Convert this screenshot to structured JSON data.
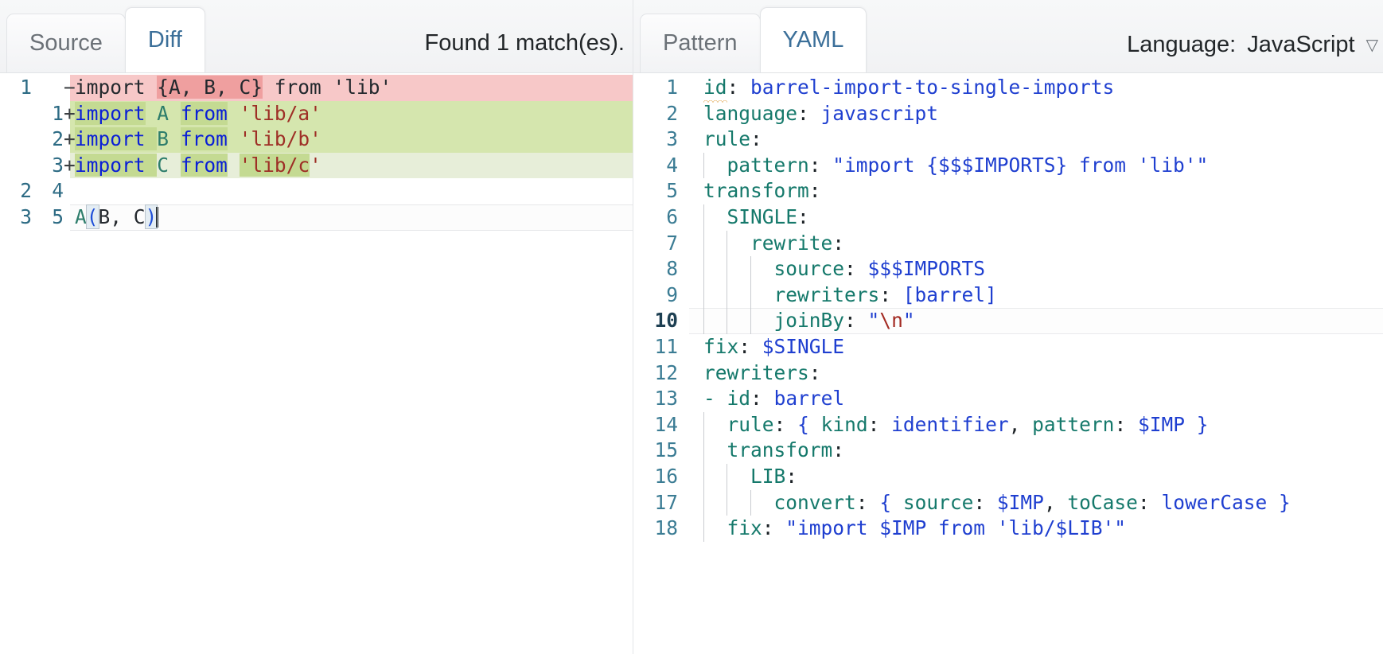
{
  "left": {
    "tabs": [
      {
        "label": "Source",
        "active": false
      },
      {
        "label": "Diff",
        "active": true
      }
    ],
    "status": "Found 1 match(es).",
    "diff": {
      "rows": [
        {
          "old_no": "1",
          "new_no": "",
          "sign": "−",
          "kind": "del",
          "segments": [
            {
              "text": "import ",
              "cls": "plain",
              "word": false
            },
            {
              "text": "{A, B, C}",
              "cls": "plain",
              "word": true
            },
            {
              "text": " from 'lib'",
              "cls": "plain",
              "word": false
            }
          ]
        },
        {
          "old_no": "",
          "new_no": "1",
          "sign": "+",
          "kind": "add",
          "segments": [
            {
              "text": "import",
              "cls": "kw",
              "word": true
            },
            {
              "text": " ",
              "cls": "plain",
              "word": false
            },
            {
              "text": "A",
              "cls": "id2",
              "word": false
            },
            {
              "text": " ",
              "cls": "plain",
              "word": false
            },
            {
              "text": "from",
              "cls": "kw",
              "word": true
            },
            {
              "text": " ",
              "cls": "plain",
              "word": false
            },
            {
              "text": "'lib/a'",
              "cls": "str",
              "word": false
            }
          ]
        },
        {
          "old_no": "",
          "new_no": "2",
          "sign": "+",
          "kind": "add",
          "segments": [
            {
              "text": "import",
              "cls": "kw",
              "word": true
            },
            {
              "text": " ",
              "cls": "plain",
              "word": true
            },
            {
              "text": "B",
              "cls": "id2",
              "word": false
            },
            {
              "text": " ",
              "cls": "plain",
              "word": false
            },
            {
              "text": "from",
              "cls": "kw",
              "word": true
            },
            {
              "text": " ",
              "cls": "plain",
              "word": false
            },
            {
              "text": "'lib/b'",
              "cls": "str",
              "word": false
            }
          ]
        },
        {
          "old_no": "",
          "new_no": "3",
          "sign": "+",
          "kind": "add-faint",
          "segments": [
            {
              "text": "import",
              "cls": "kw",
              "word": true
            },
            {
              "text": " ",
              "cls": "plain",
              "word": true
            },
            {
              "text": "C",
              "cls": "id2",
              "word": false
            },
            {
              "text": " ",
              "cls": "plain",
              "word": false
            },
            {
              "text": "from",
              "cls": "kw",
              "word": true
            },
            {
              "text": " ",
              "cls": "plain",
              "word": false
            },
            {
              "text": "'lib/c",
              "cls": "str",
              "word": true
            },
            {
              "text": "'",
              "cls": "str",
              "word": false
            }
          ]
        },
        {
          "old_no": "2",
          "new_no": "4",
          "sign": "",
          "kind": "ctx",
          "segments": []
        },
        {
          "old_no": "3",
          "new_no": "5",
          "sign": "",
          "kind": "cur",
          "segments": [
            {
              "text": "A",
              "cls": "fn",
              "word": false
            },
            {
              "text": "(",
              "cls": "punct",
              "word": false,
              "box": true
            },
            {
              "text": "B, C",
              "cls": "plain",
              "word": false
            },
            {
              "text": ")",
              "cls": "punct",
              "word": false,
              "box": true
            }
          ],
          "caret": true
        }
      ]
    }
  },
  "right": {
    "tabs": [
      {
        "label": "Pattern",
        "active": false
      },
      {
        "label": "YAML",
        "active": true
      }
    ],
    "language_label": "Language:",
    "language_value": "JavaScript",
    "caret_glyph": "▽",
    "yaml": {
      "active_line": 10,
      "lines": [
        {
          "no": "1",
          "indent": 0,
          "guides": 0,
          "text": "id: barrel-import-to-single-imports",
          "tokens": [
            {
              "t": "id",
              "c": "ykey",
              "squiggle": true
            },
            {
              "t": ":",
              "c": "ycolon"
            },
            {
              "t": " barrel-import-to-single-imports",
              "c": "yval"
            }
          ]
        },
        {
          "no": "2",
          "indent": 0,
          "guides": 0,
          "text": "language: javascript",
          "tokens": [
            {
              "t": "language",
              "c": "ykey"
            },
            {
              "t": ":",
              "c": "ycolon"
            },
            {
              "t": " javascript",
              "c": "yval"
            }
          ]
        },
        {
          "no": "3",
          "indent": 0,
          "guides": 0,
          "text": "rule:",
          "tokens": [
            {
              "t": "rule",
              "c": "ykey"
            },
            {
              "t": ":",
              "c": "ycolon"
            }
          ]
        },
        {
          "no": "4",
          "indent": 1,
          "guides": 1,
          "text": "  pattern: \"import {$$$IMPORTS} from 'lib'\"",
          "tokens": [
            {
              "t": "  ",
              "c": "plain"
            },
            {
              "t": "pattern",
              "c": "ykey"
            },
            {
              "t": ":",
              "c": "ycolon"
            },
            {
              "t": " \"import {$$$IMPORTS} from 'lib'\"",
              "c": "ystr"
            }
          ]
        },
        {
          "no": "5",
          "indent": 0,
          "guides": 0,
          "text": "transform:",
          "tokens": [
            {
              "t": "transform",
              "c": "ykey"
            },
            {
              "t": ":",
              "c": "ycolon"
            }
          ]
        },
        {
          "no": "6",
          "indent": 1,
          "guides": 1,
          "text": "  SINGLE:",
          "tokens": [
            {
              "t": "  ",
              "c": "plain"
            },
            {
              "t": "SINGLE",
              "c": "ykey"
            },
            {
              "t": ":",
              "c": "ycolon"
            }
          ]
        },
        {
          "no": "7",
          "indent": 2,
          "guides": 2,
          "text": "    rewrite:",
          "tokens": [
            {
              "t": "    ",
              "c": "plain"
            },
            {
              "t": "rewrite",
              "c": "ykey"
            },
            {
              "t": ":",
              "c": "ycolon"
            }
          ]
        },
        {
          "no": "8",
          "indent": 3,
          "guides": 3,
          "text": "      source: $$$IMPORTS",
          "tokens": [
            {
              "t": "      ",
              "c": "plain"
            },
            {
              "t": "source",
              "c": "ykey"
            },
            {
              "t": ":",
              "c": "ycolon"
            },
            {
              "t": " $$$IMPORTS",
              "c": "yval"
            }
          ]
        },
        {
          "no": "9",
          "indent": 3,
          "guides": 3,
          "text": "      rewriters: [barrel]",
          "tokens": [
            {
              "t": "      ",
              "c": "plain"
            },
            {
              "t": "rewriters",
              "c": "ykey"
            },
            {
              "t": ":",
              "c": "ycolon"
            },
            {
              "t": " [barrel]",
              "c": "yval"
            }
          ]
        },
        {
          "no": "10",
          "indent": 3,
          "guides": 3,
          "text": "      joinBy: \"\\n\"",
          "tokens": [
            {
              "t": "      ",
              "c": "plain"
            },
            {
              "t": "joinBy",
              "c": "ykey"
            },
            {
              "t": ":",
              "c": "ycolon"
            },
            {
              "t": " \"",
              "c": "ystr"
            },
            {
              "t": "\\n",
              "c": "yesc"
            },
            {
              "t": "\"",
              "c": "ystr"
            }
          ]
        },
        {
          "no": "11",
          "indent": 0,
          "guides": 0,
          "text": "fix: $SINGLE",
          "tokens": [
            {
              "t": "fix",
              "c": "ykey"
            },
            {
              "t": ":",
              "c": "ycolon"
            },
            {
              "t": " $SINGLE",
              "c": "yval"
            }
          ]
        },
        {
          "no": "12",
          "indent": 0,
          "guides": 0,
          "text": "rewriters:",
          "tokens": [
            {
              "t": "rewriters",
              "c": "ykey"
            },
            {
              "t": ":",
              "c": "ycolon"
            }
          ]
        },
        {
          "no": "13",
          "indent": 0,
          "guides": 0,
          "text": "- id: barrel",
          "tokens": [
            {
              "t": "-",
              "c": "ydash"
            },
            {
              "t": " ",
              "c": "plain"
            },
            {
              "t": "id",
              "c": "ykey"
            },
            {
              "t": ":",
              "c": "ycolon"
            },
            {
              "t": " barrel",
              "c": "yval"
            }
          ]
        },
        {
          "no": "14",
          "indent": 1,
          "guides": 1,
          "text": "  rule: { kind: identifier, pattern: $IMP }",
          "tokens": [
            {
              "t": "  ",
              "c": "plain"
            },
            {
              "t": "rule",
              "c": "ykey"
            },
            {
              "t": ":",
              "c": "ycolon"
            },
            {
              "t": " ",
              "c": "plain"
            },
            {
              "t": "{",
              "c": "yval"
            },
            {
              "t": " ",
              "c": "plain"
            },
            {
              "t": "kind",
              "c": "ykey"
            },
            {
              "t": ":",
              "c": "ycolon"
            },
            {
              "t": " identifier",
              "c": "yval"
            },
            {
              "t": ",",
              "c": "ycolon"
            },
            {
              "t": " ",
              "c": "plain"
            },
            {
              "t": "pattern",
              "c": "ykey"
            },
            {
              "t": ":",
              "c": "ycolon"
            },
            {
              "t": " $IMP }",
              "c": "yval"
            }
          ]
        },
        {
          "no": "15",
          "indent": 1,
          "guides": 1,
          "text": "  transform:",
          "tokens": [
            {
              "t": "  ",
              "c": "plain"
            },
            {
              "t": "transform",
              "c": "ykey"
            },
            {
              "t": ":",
              "c": "ycolon"
            }
          ]
        },
        {
          "no": "16",
          "indent": 2,
          "guides": 2,
          "text": "    LIB:",
          "tokens": [
            {
              "t": "    ",
              "c": "plain"
            },
            {
              "t": "LIB",
              "c": "ykey"
            },
            {
              "t": ":",
              "c": "ycolon"
            }
          ]
        },
        {
          "no": "17",
          "indent": 3,
          "guides": 3,
          "text": "      convert: { source: $IMP, toCase: lowerCase }",
          "tokens": [
            {
              "t": "      ",
              "c": "plain"
            },
            {
              "t": "convert",
              "c": "ykey"
            },
            {
              "t": ":",
              "c": "ycolon"
            },
            {
              "t": " ",
              "c": "plain"
            },
            {
              "t": "{",
              "c": "yval"
            },
            {
              "t": " ",
              "c": "plain"
            },
            {
              "t": "source",
              "c": "ykey"
            },
            {
              "t": ":",
              "c": "ycolon"
            },
            {
              "t": " $IMP",
              "c": "yval"
            },
            {
              "t": ",",
              "c": "ycolon"
            },
            {
              "t": " ",
              "c": "plain"
            },
            {
              "t": "toCase",
              "c": "ykey"
            },
            {
              "t": ":",
              "c": "ycolon"
            },
            {
              "t": " lowerCase }",
              "c": "yval"
            }
          ]
        },
        {
          "no": "18",
          "indent": 1,
          "guides": 1,
          "text": "  fix: \"import $IMP from 'lib/$LIB'\"",
          "tokens": [
            {
              "t": "  ",
              "c": "plain"
            },
            {
              "t": "fix",
              "c": "ykey"
            },
            {
              "t": ":",
              "c": "ycolon"
            },
            {
              "t": " \"import $IMP from 'lib/$LIB'\"",
              "c": "ystr"
            }
          ]
        }
      ]
    }
  },
  "colors": {
    "accent": "#3b6f99",
    "diff_removed_bg": "#f7c8c8",
    "diff_removed_word_bg": "#ef9f9f",
    "diff_added_bg": "#d5e6ae",
    "diff_added_word_bg": "#c4da92",
    "yaml_key": "#15796b",
    "yaml_value": "#1f3fd0",
    "gutter_number": "#2d6b84"
  }
}
